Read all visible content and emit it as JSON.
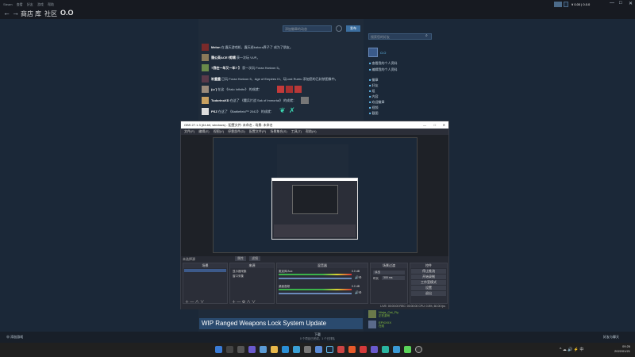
{
  "menubar": {
    "items": [
      "Steam",
      "查看",
      "好友",
      "游戏",
      "帮助"
    ]
  },
  "nav": {
    "back": "←",
    "forward": "→",
    "store": "商店",
    "library": "库",
    "community": "社区",
    "username": "O.O"
  },
  "account": {
    "label": "¥ 0.00 | 0.0.0"
  },
  "window_controls": {
    "minimize": "—",
    "maximize": "□",
    "close": "✕"
  },
  "feed": {
    "filter_label": "添加徽章的动态",
    "post_button": "发布",
    "rows": [
      {
        "user": "Melon",
        "text": "在 露天游戏机、露天经kakura界子了 成为了朋友。"
      },
      {
        "user": "蒲公英ACE?剪辑",
        "text": "获一次玩 VUP。"
      },
      {
        "user": "?我在一年又一年? 】",
        "text": "获一次玩 Forza Horizon 5。"
      },
      {
        "user": "补重重",
        "text": "已玩 Forza Horizon 5、Age of Empires IV、玩Lost Rueru 添加您的已封禁图像中。"
      },
      {
        "user": "(ω ̄)",
        "text": "在这 《Halo Infinite》 的成就："
      },
      {
        "user": "TudorinoXD",
        "text": "在这了 《魔兵片战 Sak of Immortal》 的成就："
      },
      {
        "user": "PSZ",
        "text": "在这了 《Battlefield™ 2042》 的成就："
      }
    ],
    "wip_title": "WIP Ranged Weapons Lock System Update"
  },
  "rightcol": {
    "search_placeholder": "搜索您的好友",
    "profile_name": "O.O",
    "links": [
      "查看我的个人资料",
      "编辑我的个人资料",
      "徽章",
      "好友",
      "组",
      "内容",
      "欢迎徽章",
      "视频",
      "截图"
    ],
    "bottom_users": [
      {
        "name": "Ninja_Cat_Fly",
        "status": "正在游戏"
      },
      {
        "name": "EPXXXX",
        "status": "在线"
      }
    ]
  },
  "obs": {
    "title": "OBS 27.1.3 (64-bit, windows) - 配置文件: 未命名 - 场景: 未命名",
    "menu": [
      "文件(F)",
      "编辑(E)",
      "视图(V)",
      "停靠部件(D)",
      "配置文件(P)",
      "场景集合(S)",
      "工具(T)",
      "帮助(H)"
    ],
    "no_source": "未选择源",
    "properties": "属性",
    "filters": "滤镜",
    "panels": {
      "scenes": "场景",
      "sources": "来源",
      "mixer": "混音器",
      "transitions": "场景过渡",
      "controls": "控件"
    },
    "sources": [
      "显示器采集",
      "窗口采集"
    ],
    "mixer_tracks": [
      {
        "name": "麦克风/Aux",
        "level": "0.0 dB"
      },
      {
        "name": "桌面音频",
        "level": "0.0 dB"
      }
    ],
    "transitions": {
      "type_label": "淡出",
      "duration_label": "时长",
      "duration_value": "300 ms"
    },
    "controls": [
      "停止推流",
      "开始录制",
      "工作室模式",
      "设置",
      "退出"
    ],
    "status": "LIVE: 00:00:00   REC: 00:00:00   CPU: 0.8%, 60.00 fps"
  },
  "steam_bottom": {
    "manage": "添加游戏",
    "downloads": "下载",
    "downloads_sub": "0 个项目已完成，1 个已排队",
    "friends": "好友与聊天"
  },
  "taskbar": {
    "clock_time": "09:26",
    "clock_date": "2022/01/21"
  }
}
